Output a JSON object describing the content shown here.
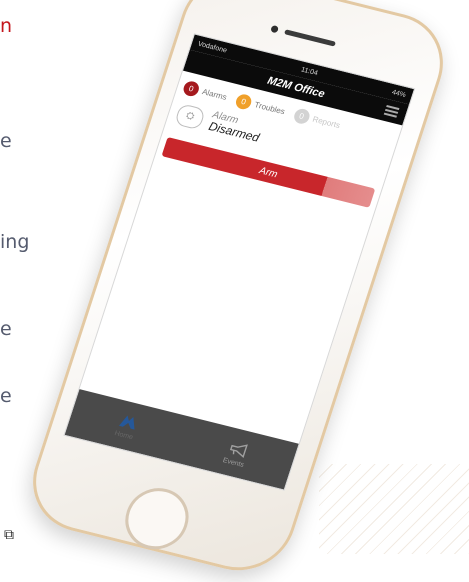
{
  "background": {
    "left_text_fragments": {
      "top_red_char": "n",
      "line_1": "e",
      "line_2": "ing",
      "line_3": "e",
      "line_4": "e"
    },
    "bottom_left_glyph": "⧉"
  },
  "phone": {
    "status": {
      "carrier": "Vodafone",
      "time": "11:04",
      "battery": "44%"
    },
    "nav": {
      "title": "M2M Office"
    },
    "tabs": [
      {
        "count": "0",
        "label": "Alarms",
        "color": "#a5191e"
      },
      {
        "count": "0",
        "label": "Troubles",
        "color": "#f0a02a"
      },
      {
        "count": "0",
        "label": "Reports",
        "color": "#d3d3d3"
      }
    ],
    "alarm": {
      "title": "Alarm",
      "state": "Disarmed"
    },
    "arm_button": {
      "label": "Arm"
    },
    "bottom_bar": {
      "items": [
        {
          "label": "Home",
          "icon": "home-icon"
        },
        {
          "label": "Events",
          "icon": "megaphone-icon"
        }
      ]
    }
  }
}
